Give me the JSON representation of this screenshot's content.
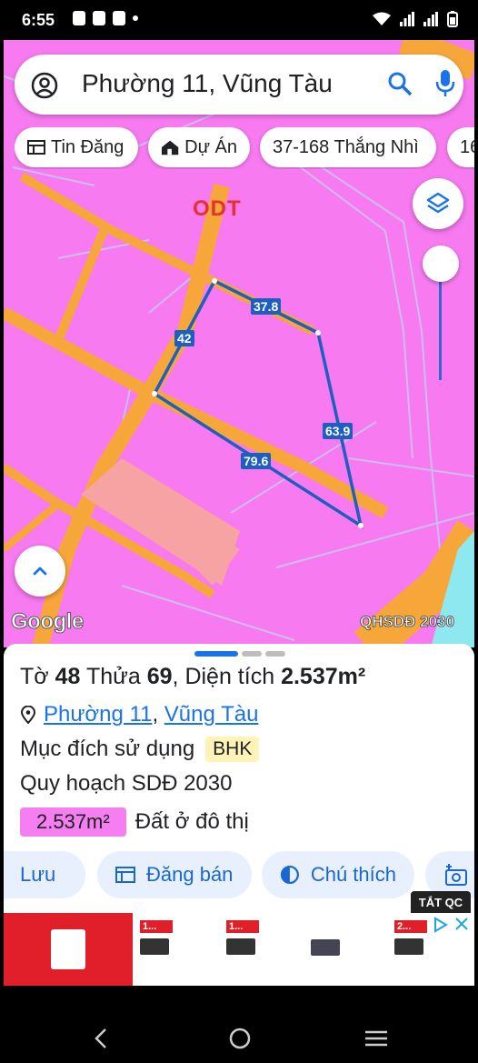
{
  "status_bar": {
    "time": "6:55"
  },
  "search": {
    "query": "Phường 11, Vũng Tàu"
  },
  "chips": [
    {
      "label": "Tin Đăng",
      "icon": "newspaper-icon"
    },
    {
      "label": "Dự Án",
      "icon": "building-icon"
    },
    {
      "label": "37-168 Thắng Nhì",
      "icon": ""
    },
    {
      "label": "16",
      "icon": ""
    }
  ],
  "map": {
    "zone_code": "ODT",
    "edges": [
      "37.8",
      "42",
      "63.9",
      "79.6"
    ],
    "attribution": "Google",
    "layer_label": "QHSDĐ 2030",
    "colors": {
      "residential": "#f77af0",
      "road": "#f7a63a",
      "boundary": "#1d5fbf",
      "special": "#f7a3a3"
    }
  },
  "parcel": {
    "sheet_label": "Tờ",
    "sheet": "48",
    "plot_label": "Thửa",
    "plot": "69",
    "area_label": "Diện tích",
    "area": "2.537m²",
    "ward": "Phường 11",
    "city": "Vũng Tàu",
    "purpose_label": "Mục đích sử dụng",
    "purpose_code": "BHK",
    "plan": "Quy hoạch SDĐ 2030",
    "plan_area": "2.537m²",
    "plan_desc": "Đất ở đô thị"
  },
  "actions": [
    {
      "label": "Lưu",
      "icon": "bookmark-icon"
    },
    {
      "label": "Đăng bán",
      "icon": "listing-icon"
    },
    {
      "label": "Chú thích",
      "icon": "legend-icon"
    },
    {
      "label": "",
      "icon": "camera-add-icon"
    }
  ],
  "ad": {
    "close_label": "TẮT QC",
    "items": [
      "1...",
      "1...",
      "",
      "2..."
    ]
  }
}
